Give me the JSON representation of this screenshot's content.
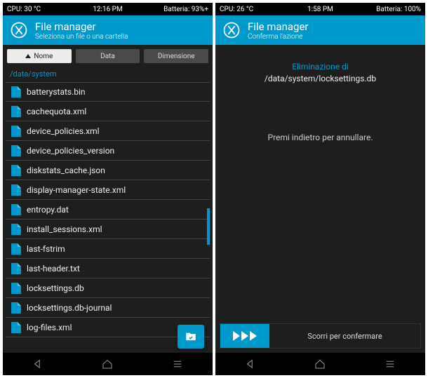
{
  "left": {
    "status": {
      "cpu": "CPU: 30 °C",
      "time": "12:16 PM",
      "battery": "Batteria: 93%+"
    },
    "header": {
      "title": "File manager",
      "subtitle": "Seleziona un file o una cartella"
    },
    "sort": {
      "name": "Nome",
      "date": "Data",
      "size": "Dimensione"
    },
    "path": "/data/system",
    "files": [
      "batterystats.bin",
      "cachequota.xml",
      "device_policies.xml",
      "device_policies_version",
      "diskstats_cache.json",
      "display-manager-state.xml",
      "entropy.dat",
      "install_sessions.xml",
      "last-fstrim",
      "last-header.txt",
      "locksettings.db",
      "locksettings.db-journal",
      "log-files.xml"
    ]
  },
  "right": {
    "status": {
      "cpu": "CPU: 26 °C",
      "time": "1:58 PM",
      "battery": "Batteria: 100%"
    },
    "header": {
      "title": "File manager",
      "subtitle": "Conferma l'azione"
    },
    "confirm": {
      "heading": "Eliminazione di",
      "target": "/data/system/locksettings.db",
      "hint": "Premi indietro per annullare.",
      "swipe": "Scorri per confermare"
    }
  },
  "colors": {
    "accent": "#0099cc",
    "bg": "#1e1e1e"
  }
}
